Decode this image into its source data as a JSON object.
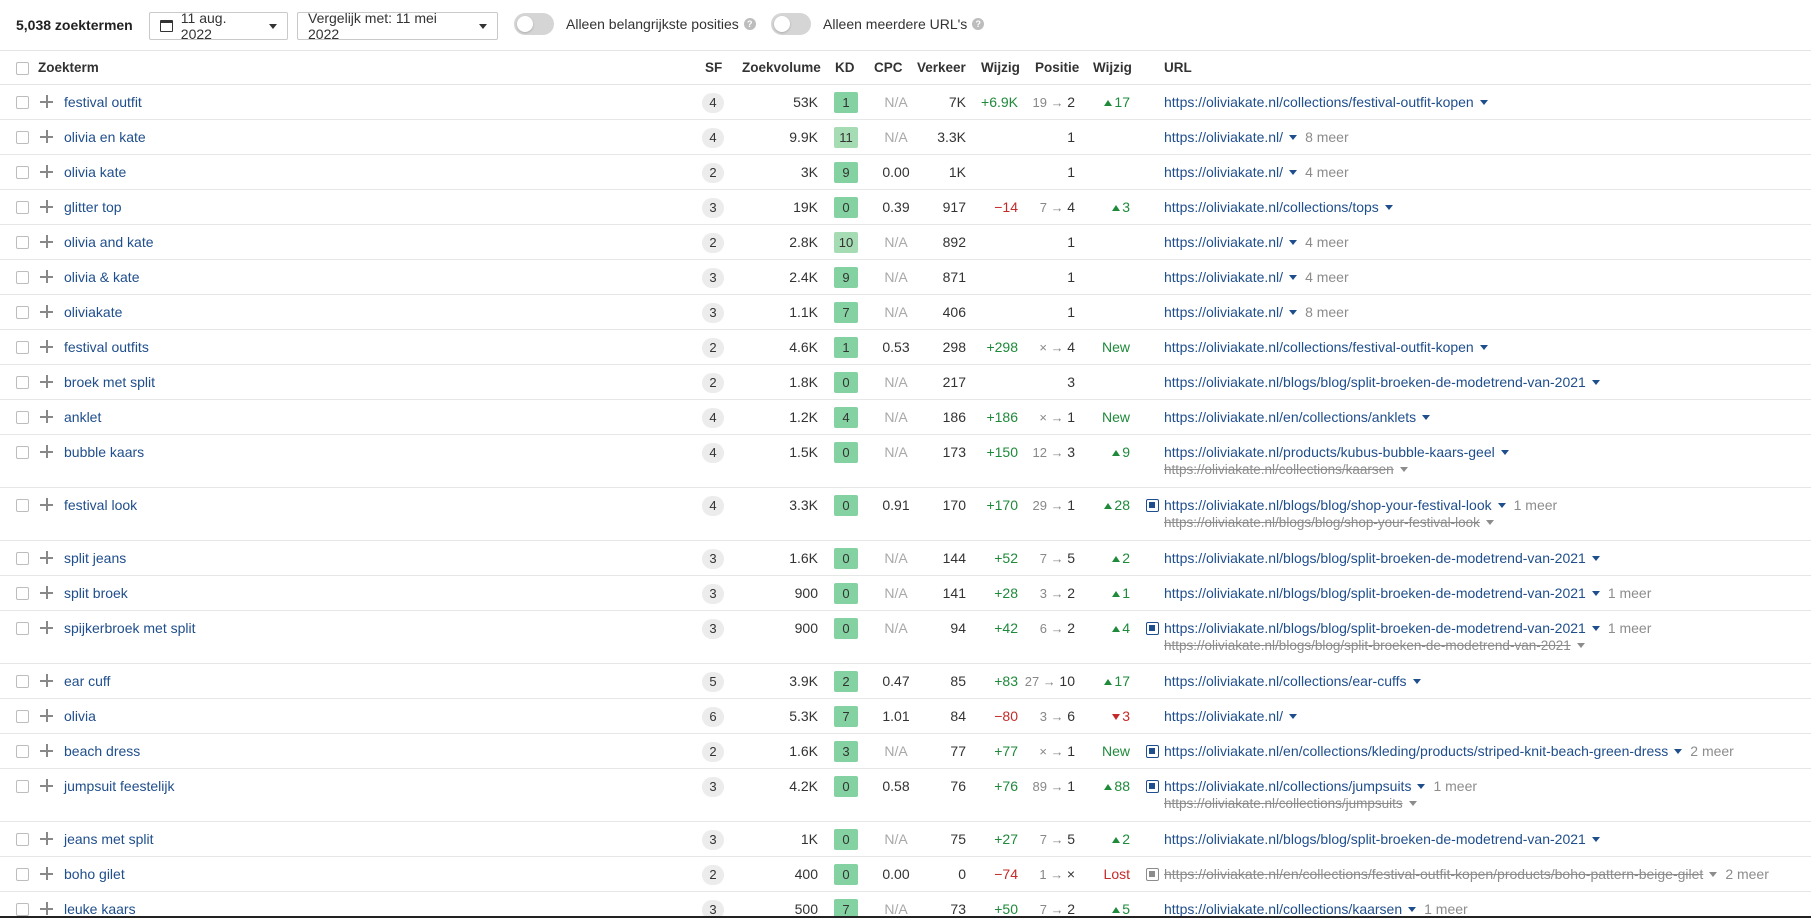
{
  "toolbar": {
    "count": "5,038 zoektermen",
    "date": "11 aug. 2022",
    "compare": "Vergelijk met: 11 mei 2022",
    "toggle1": "Alleen belangrijkste posities",
    "toggle2": "Alleen meerdere URL's"
  },
  "headers": {
    "keyword": "Zoekterm",
    "sf": "SF",
    "volume": "Zoekvolume",
    "kd": "KD",
    "cpc": "CPC",
    "traffic": "Verkeer",
    "change": "Wijzig",
    "position": "Positie",
    "change2": "Wijzig",
    "url": "URL"
  },
  "rows": [
    {
      "kw": "festival outfit",
      "sf": "4",
      "vol": "53K",
      "kd": "1",
      "cpc": "N/A",
      "traffic": "7K",
      "chg": "+6.9K",
      "pos_from": "19",
      "pos_to": "2",
      "wz": "17",
      "wz_dir": "up",
      "url": "https://oliviakate.nl/collections/festival-outfit-kopen",
      "more": "",
      "url2": ""
    },
    {
      "kw": "olivia en kate",
      "sf": "4",
      "vol": "9.9K",
      "kd": "11",
      "cpc": "N/A",
      "traffic": "3.3K",
      "chg": "",
      "pos_from": "",
      "pos_to": "1",
      "wz": "",
      "wz_dir": "",
      "url": "https://oliviakate.nl/",
      "more": "8 meer",
      "url2": ""
    },
    {
      "kw": "olivia kate",
      "sf": "2",
      "vol": "3K",
      "kd": "9",
      "cpc": "0.00",
      "traffic": "1K",
      "chg": "",
      "pos_from": "",
      "pos_to": "1",
      "wz": "",
      "wz_dir": "",
      "url": "https://oliviakate.nl/",
      "more": "4 meer",
      "url2": ""
    },
    {
      "kw": "glitter top",
      "sf": "3",
      "vol": "19K",
      "kd": "0",
      "cpc": "0.39",
      "traffic": "917",
      "chg": "−14",
      "pos_from": "7",
      "pos_to": "4",
      "wz": "3",
      "wz_dir": "up",
      "url": "https://oliviakate.nl/collections/tops",
      "more": "",
      "url2": ""
    },
    {
      "kw": "olivia and kate",
      "sf": "2",
      "vol": "2.8K",
      "kd": "10",
      "cpc": "N/A",
      "traffic": "892",
      "chg": "",
      "pos_from": "",
      "pos_to": "1",
      "wz": "",
      "wz_dir": "",
      "url": "https://oliviakate.nl/",
      "more": "4 meer",
      "url2": ""
    },
    {
      "kw": "olivia & kate",
      "sf": "3",
      "vol": "2.4K",
      "kd": "9",
      "cpc": "N/A",
      "traffic": "871",
      "chg": "",
      "pos_from": "",
      "pos_to": "1",
      "wz": "",
      "wz_dir": "",
      "url": "https://oliviakate.nl/",
      "more": "4 meer",
      "url2": ""
    },
    {
      "kw": "oliviakate",
      "sf": "3",
      "vol": "1.1K",
      "kd": "7",
      "cpc": "N/A",
      "traffic": "406",
      "chg": "",
      "pos_from": "",
      "pos_to": "1",
      "wz": "",
      "wz_dir": "",
      "url": "https://oliviakate.nl/",
      "more": "8 meer",
      "url2": ""
    },
    {
      "kw": "festival outfits",
      "sf": "2",
      "vol": "4.6K",
      "kd": "1",
      "cpc": "0.53",
      "traffic": "298",
      "chg": "+298",
      "pos_from": "×",
      "pos_to": "4",
      "wz": "New",
      "wz_dir": "new",
      "url": "https://oliviakate.nl/collections/festival-outfit-kopen",
      "more": "",
      "url2": ""
    },
    {
      "kw": "broek met split",
      "sf": "2",
      "vol": "1.8K",
      "kd": "0",
      "cpc": "N/A",
      "traffic": "217",
      "chg": "",
      "pos_from": "",
      "pos_to": "3",
      "wz": "",
      "wz_dir": "",
      "url": "https://oliviakate.nl/blogs/blog/split-broeken-de-modetrend-van-2021",
      "more": "",
      "url2": ""
    },
    {
      "kw": "anklet",
      "sf": "4",
      "vol": "1.2K",
      "kd": "4",
      "cpc": "N/A",
      "traffic": "186",
      "chg": "+186",
      "pos_from": "×",
      "pos_to": "1",
      "wz": "New",
      "wz_dir": "new",
      "url": "https://oliviakate.nl/en/collections/anklets",
      "more": "",
      "url2": ""
    },
    {
      "kw": "bubble kaars",
      "sf": "4",
      "vol": "1.5K",
      "kd": "0",
      "cpc": "N/A",
      "traffic": "173",
      "chg": "+150",
      "pos_from": "12",
      "pos_to": "3",
      "wz": "9",
      "wz_dir": "up",
      "url": "https://oliviakate.nl/products/kubus-bubble-kaars-geel",
      "more": "",
      "url2": "https://oliviakate.nl/collections/kaarsen"
    },
    {
      "kw": "festival look",
      "sf": "4",
      "vol": "3.3K",
      "kd": "0",
      "cpc": "0.91",
      "traffic": "170",
      "chg": "+170",
      "pos_from": "29",
      "pos_to": "1",
      "wz": "28",
      "wz_dir": "up",
      "url": "https://oliviakate.nl/blogs/blog/shop-your-festival-look",
      "more": "1 meer",
      "url2": "https://oliviakate.nl/blogs/blog/shop-your-festival-look",
      "snip": "blue"
    },
    {
      "kw": "split jeans",
      "sf": "3",
      "vol": "1.6K",
      "kd": "0",
      "cpc": "N/A",
      "traffic": "144",
      "chg": "+52",
      "pos_from": "7",
      "pos_to": "5",
      "wz": "2",
      "wz_dir": "up",
      "url": "https://oliviakate.nl/blogs/blog/split-broeken-de-modetrend-van-2021",
      "more": "",
      "url2": ""
    },
    {
      "kw": "split broek",
      "sf": "3",
      "vol": "900",
      "kd": "0",
      "cpc": "N/A",
      "traffic": "141",
      "chg": "+28",
      "pos_from": "3",
      "pos_to": "2",
      "wz": "1",
      "wz_dir": "up",
      "url": "https://oliviakate.nl/blogs/blog/split-broeken-de-modetrend-van-2021",
      "more": "1 meer",
      "url2": ""
    },
    {
      "kw": "spijkerbroek met split",
      "sf": "3",
      "vol": "900",
      "kd": "0",
      "cpc": "N/A",
      "traffic": "94",
      "chg": "+42",
      "pos_from": "6",
      "pos_to": "2",
      "wz": "4",
      "wz_dir": "up",
      "url": "https://oliviakate.nl/blogs/blog/split-broeken-de-modetrend-van-2021",
      "more": "1 meer",
      "url2": "https://oliviakate.nl/blogs/blog/split-broeken-de-modetrend-van-2021",
      "snip": "blue"
    },
    {
      "kw": "ear cuff",
      "sf": "5",
      "vol": "3.9K",
      "kd": "2",
      "cpc": "0.47",
      "traffic": "85",
      "chg": "+83",
      "pos_from": "27",
      "pos_to": "10",
      "wz": "17",
      "wz_dir": "up",
      "url": "https://oliviakate.nl/collections/ear-cuffs",
      "more": "",
      "url2": ""
    },
    {
      "kw": "olivia",
      "sf": "6",
      "vol": "5.3K",
      "kd": "7",
      "cpc": "1.01",
      "traffic": "84",
      "chg": "−80",
      "pos_from": "3",
      "pos_to": "6",
      "wz": "3",
      "wz_dir": "down",
      "url": "https://oliviakate.nl/",
      "more": "",
      "url2": ""
    },
    {
      "kw": "beach dress",
      "sf": "2",
      "vol": "1.6K",
      "kd": "3",
      "cpc": "N/A",
      "traffic": "77",
      "chg": "+77",
      "pos_from": "×",
      "pos_to": "1",
      "wz": "New",
      "wz_dir": "new",
      "url": "https://oliviakate.nl/en/collections/kleding/products/striped-knit-beach-green-dress",
      "more": "2 meer",
      "url2": "",
      "snip": "blue"
    },
    {
      "kw": "jumpsuit feestelijk",
      "sf": "3",
      "vol": "4.2K",
      "kd": "0",
      "cpc": "0.58",
      "traffic": "76",
      "chg": "+76",
      "pos_from": "89",
      "pos_to": "1",
      "wz": "88",
      "wz_dir": "up",
      "url": "https://oliviakate.nl/collections/jumpsuits",
      "more": "1 meer",
      "url2": "https://oliviakate.nl/collections/jumpsuits",
      "snip": "blue"
    },
    {
      "kw": "jeans met split",
      "sf": "3",
      "vol": "1K",
      "kd": "0",
      "cpc": "N/A",
      "traffic": "75",
      "chg": "+27",
      "pos_from": "7",
      "pos_to": "5",
      "wz": "2",
      "wz_dir": "up",
      "url": "https://oliviakate.nl/blogs/blog/split-broeken-de-modetrend-van-2021",
      "more": "",
      "url2": ""
    },
    {
      "kw": "boho gilet",
      "sf": "2",
      "vol": "400",
      "kd": "0",
      "cpc": "0.00",
      "traffic": "0",
      "chg": "−74",
      "pos_from": "1",
      "pos_to": "×",
      "wz": "Lost",
      "wz_dir": "lost",
      "url": "https://oliviakate.nl/en/collections/festival-outfit-kopen/products/boho-pattern-beige-gilet",
      "more": "2 meer",
      "url2": "",
      "snip": "grey",
      "lost": true
    },
    {
      "kw": "leuke kaars",
      "sf": "3",
      "vol": "500",
      "kd": "7",
      "cpc": "N/A",
      "traffic": "73",
      "chg": "+50",
      "pos_from": "7",
      "pos_to": "2",
      "wz": "5",
      "wz_dir": "up",
      "url": "https://oliviakate.nl/collections/kaarsen",
      "more": "1 meer",
      "url2": ""
    }
  ],
  "colors": {
    "link": "#1f4e8c",
    "positive": "#1e8a3a",
    "negative": "#c42a2a",
    "kd_green": "#84d2a1"
  }
}
